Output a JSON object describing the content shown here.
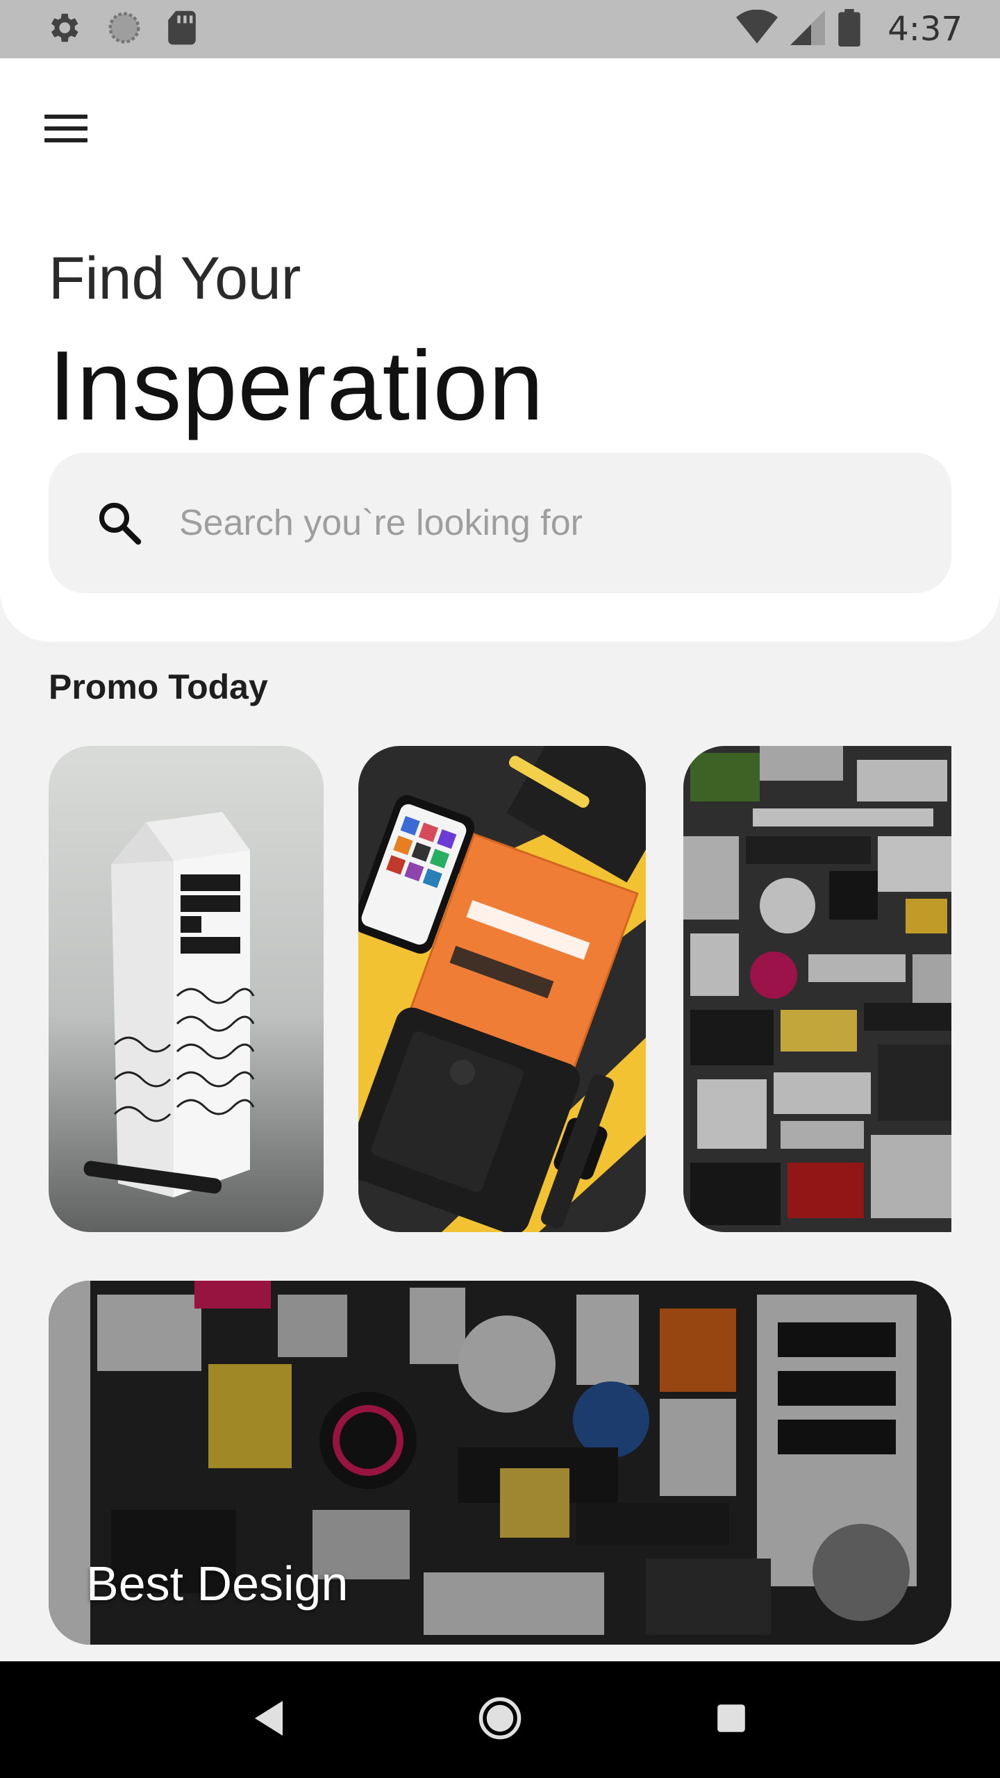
{
  "status_bar": {
    "time": "4:37",
    "left_icons": [
      "settings-icon",
      "sync-icon",
      "sd-card-icon"
    ],
    "right_icons": [
      "wifi-icon",
      "signal-icon",
      "battery-icon"
    ]
  },
  "header": {
    "menu_icon": "menu-icon",
    "title_line1": "Find Your",
    "title_line2": "Insperation"
  },
  "search": {
    "placeholder": "Search you`re looking for",
    "value": ""
  },
  "promo": {
    "section_title": "Promo Today",
    "cards": [
      {
        "subject": "boxed-water-carton"
      },
      {
        "subject": "change-by-design-book"
      },
      {
        "subject": "sticker-wall"
      }
    ]
  },
  "banner": {
    "label": "Best Design"
  },
  "nav": {
    "items": [
      "back-icon",
      "home-icon",
      "recents-icon"
    ]
  },
  "colors": {
    "background": "#f2f2f2",
    "card": "#ffffff",
    "status_bar": "#bdbdbd",
    "nav_bar": "#000000"
  }
}
